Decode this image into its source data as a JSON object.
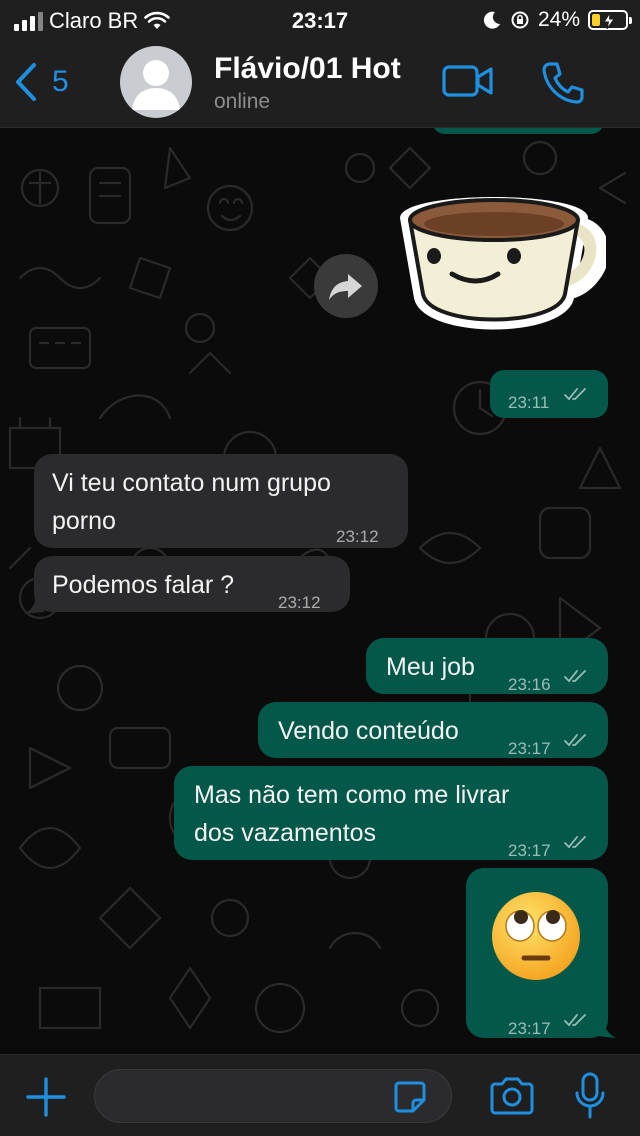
{
  "status_bar": {
    "carrier": "Claro BR",
    "time": "23:17",
    "battery": "24%",
    "battery_level": 0.24
  },
  "header": {
    "back_count": "5",
    "contact_name": "Flávio/01 Hot",
    "contact_status": "online",
    "icons": [
      "chevron-left-icon",
      "video-camera-icon",
      "phone-icon"
    ]
  },
  "messages": [
    {
      "type": "sticker",
      "direction": "out",
      "sticker": "coffee-cup-sticker",
      "time": "23:11",
      "ticks": "double"
    },
    {
      "type": "text",
      "direction": "in",
      "text_line1": "Vi teu contato num grupo",
      "text_line2": "porno",
      "time": "23:12"
    },
    {
      "type": "text",
      "direction": "in",
      "text": "Podemos falar ?",
      "time": "23:12"
    },
    {
      "type": "text",
      "direction": "out",
      "text": "Meu job",
      "time": "23:16",
      "ticks": "double"
    },
    {
      "type": "text",
      "direction": "out",
      "text": "Vendo conteúdo",
      "time": "23:17",
      "ticks": "double"
    },
    {
      "type": "text",
      "direction": "out",
      "text_line1": "Mas não tem como me livrar",
      "text_line2": "dos vazamentos",
      "time": "23:17",
      "ticks": "double"
    },
    {
      "type": "emoji",
      "direction": "out",
      "emoji": "rolling-eyes-emoji",
      "time": "23:17",
      "ticks": "double"
    }
  ],
  "input_bar": {
    "icons": [
      "plus-icon",
      "sticker-icon",
      "camera-icon",
      "microphone-icon"
    ]
  },
  "colors": {
    "accent": "#1f8fe0",
    "outgoing_bubble": "#04584a",
    "incoming_bubble": "#2b2b2d",
    "background": "#0b0b0b",
    "bar": "#1f1f1f"
  }
}
